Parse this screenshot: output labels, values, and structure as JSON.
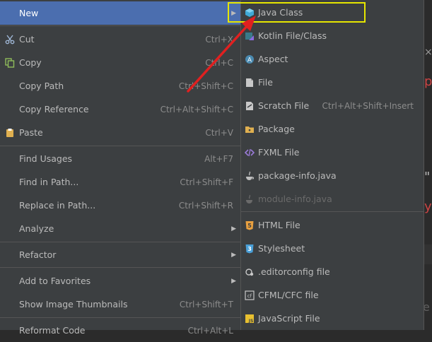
{
  "context_menu": {
    "items": [
      {
        "label": "New",
        "shortcut": "",
        "submenu": true,
        "icon": "",
        "selected": true
      },
      {
        "label": "Cut",
        "shortcut": "Ctrl+X",
        "icon": "scissors-icon"
      },
      {
        "label": "Copy",
        "shortcut": "Ctrl+C",
        "icon": "copy-icon"
      },
      {
        "label": "Copy Path",
        "shortcut": "Ctrl+Shift+C",
        "icon": ""
      },
      {
        "label": "Copy Reference",
        "shortcut": "Ctrl+Alt+Shift+C",
        "icon": ""
      },
      {
        "label": "Paste",
        "shortcut": "Ctrl+V",
        "icon": "clipboard-icon"
      },
      {
        "label": "Find Usages",
        "shortcut": "Alt+F7",
        "icon": ""
      },
      {
        "label": "Find in Path...",
        "shortcut": "Ctrl+Shift+F",
        "icon": ""
      },
      {
        "label": "Replace in Path...",
        "shortcut": "Ctrl+Shift+R",
        "icon": ""
      },
      {
        "label": "Analyze",
        "shortcut": "",
        "submenu": true,
        "icon": ""
      },
      {
        "label": "Refactor",
        "shortcut": "",
        "submenu": true,
        "icon": ""
      },
      {
        "label": "Add to Favorites",
        "shortcut": "",
        "submenu": true,
        "icon": ""
      },
      {
        "label": "Show Image Thumbnails",
        "shortcut": "Ctrl+Shift+T",
        "icon": ""
      },
      {
        "label": "Reformat Code",
        "shortcut": "Ctrl+Alt+L",
        "icon": ""
      }
    ]
  },
  "new_submenu": {
    "items": [
      {
        "label": "Java Class",
        "shortcut": "",
        "icon": "java-class-icon",
        "highlighted": true
      },
      {
        "label": "Kotlin File/Class",
        "shortcut": "",
        "icon": "kotlin-icon"
      },
      {
        "label": "Aspect",
        "shortcut": "",
        "icon": "aspect-icon"
      },
      {
        "label": "File",
        "shortcut": "",
        "icon": "file-icon"
      },
      {
        "label": "Scratch File",
        "shortcut": "Ctrl+Alt+Shift+Insert",
        "icon": "scratch-file-icon"
      },
      {
        "label": "Package",
        "shortcut": "",
        "icon": "package-icon"
      },
      {
        "label": "FXML File",
        "shortcut": "",
        "icon": "fxml-icon"
      },
      {
        "label": "package-info.java",
        "shortcut": "",
        "icon": "java-file-icon"
      },
      {
        "label": "module-info.java",
        "shortcut": "",
        "icon": "java-file-icon",
        "disabled": true
      },
      {
        "label": "HTML File",
        "shortcut": "",
        "icon": "html-icon"
      },
      {
        "label": "Stylesheet",
        "shortcut": "",
        "icon": "css-icon"
      },
      {
        "label": ".editorconfig file",
        "shortcut": "",
        "icon": "editorconfig-icon"
      },
      {
        "label": "CFML/CFC file",
        "shortcut": "",
        "icon": "cfml-icon"
      },
      {
        "label": "JavaScript File",
        "shortcut": "",
        "icon": "javascript-icon"
      }
    ]
  },
  "colors": {
    "menu_bg": "#3c3f41",
    "selection": "#4b6eaf",
    "annotation_box": "#e6e600",
    "annotation_arrow": "#e02020"
  }
}
